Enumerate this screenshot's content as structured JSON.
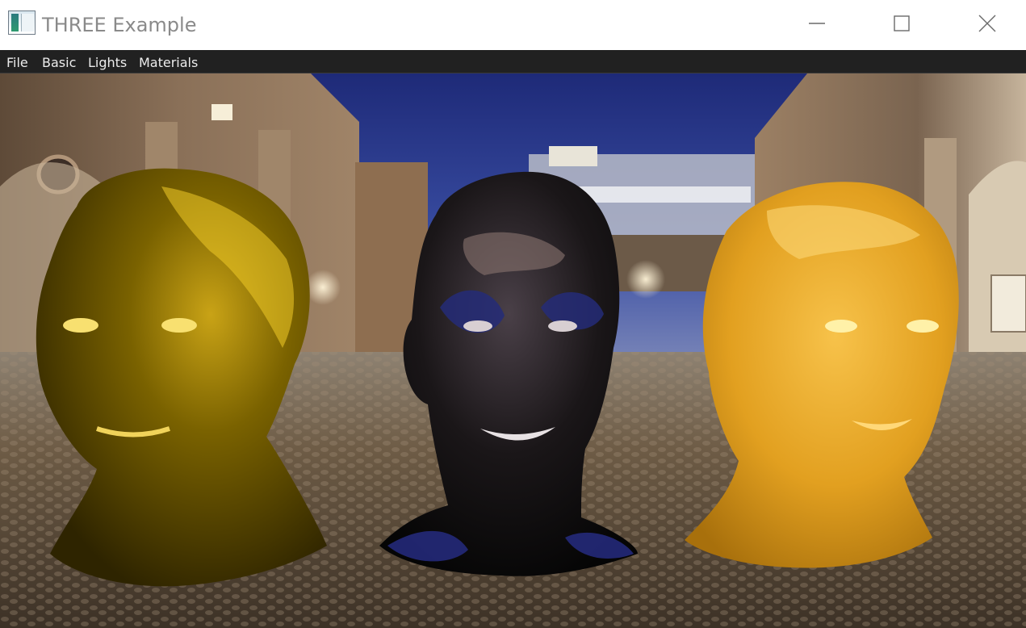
{
  "window": {
    "title": "THREE Example",
    "app_icon": "window-app-icon",
    "controls": {
      "minimize_icon": "minimize-icon",
      "maximize_icon": "maximize-icon",
      "close_icon": "close-icon"
    }
  },
  "menubar": {
    "items": [
      {
        "label": "File"
      },
      {
        "label": "Basic"
      },
      {
        "label": "Lights"
      },
      {
        "label": "Materials"
      }
    ]
  },
  "scene": {
    "environment": "night-plaza-cobblestone-courtyard",
    "models": [
      {
        "name": "gold-metallic-head",
        "color": "#7a6400"
      },
      {
        "name": "black-glossy-head",
        "color": "#141414"
      },
      {
        "name": "amber-glossy-head",
        "color": "#e8a21c"
      }
    ]
  },
  "colors": {
    "titlebar_bg": "#ffffff",
    "menubar_bg": "#212121",
    "menu_text": "#ececec",
    "title_text": "#8a8a8a",
    "sky": "#2b3a8c",
    "ground": "#6b5a44"
  }
}
